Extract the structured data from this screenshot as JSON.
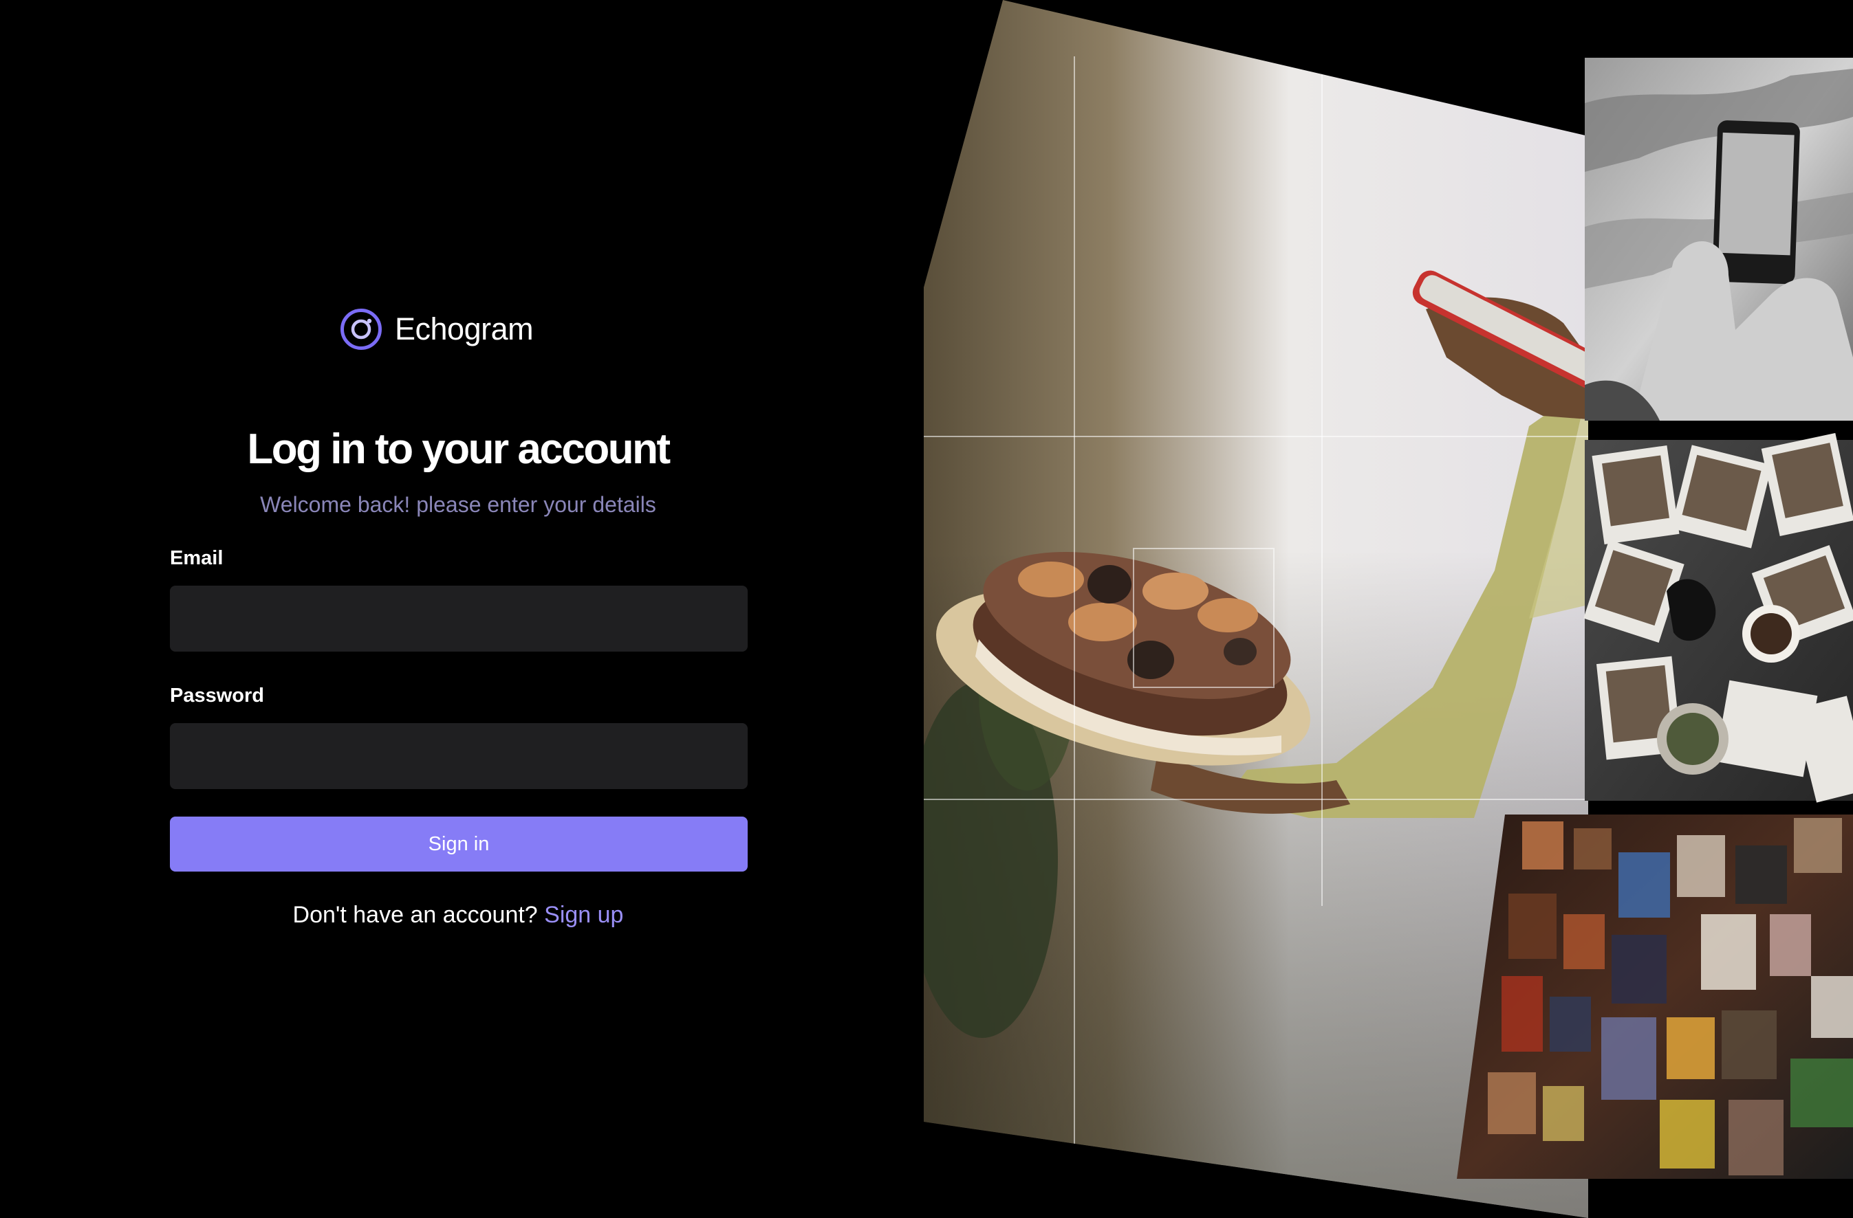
{
  "brand": {
    "name": "Echogram",
    "logo_icon": "camera-lens-icon",
    "accent_color": "#7b6cf6"
  },
  "login": {
    "title": "Log in to your account",
    "subtitle": "Welcome back! please enter your details",
    "email": {
      "label": "Email",
      "value": "",
      "placeholder": ""
    },
    "password": {
      "label": "Password",
      "value": "",
      "placeholder": ""
    },
    "submit_label": "Sign in",
    "signup_prompt": "Don't have an account?",
    "signup_link": "Sign up"
  },
  "colors": {
    "background": "#000000",
    "input_background": "#1f1f21",
    "button": "#867cf6",
    "link": "#9a8ff7",
    "subtitle": "#8a86b8"
  },
  "collage": {
    "photos": [
      "hand-holding-cake-and-phone-photo",
      "phone-photographing-architecture-photo",
      "scattered-polaroids-with-coffee-photo",
      "blurred-photo-wall-photo"
    ]
  }
}
